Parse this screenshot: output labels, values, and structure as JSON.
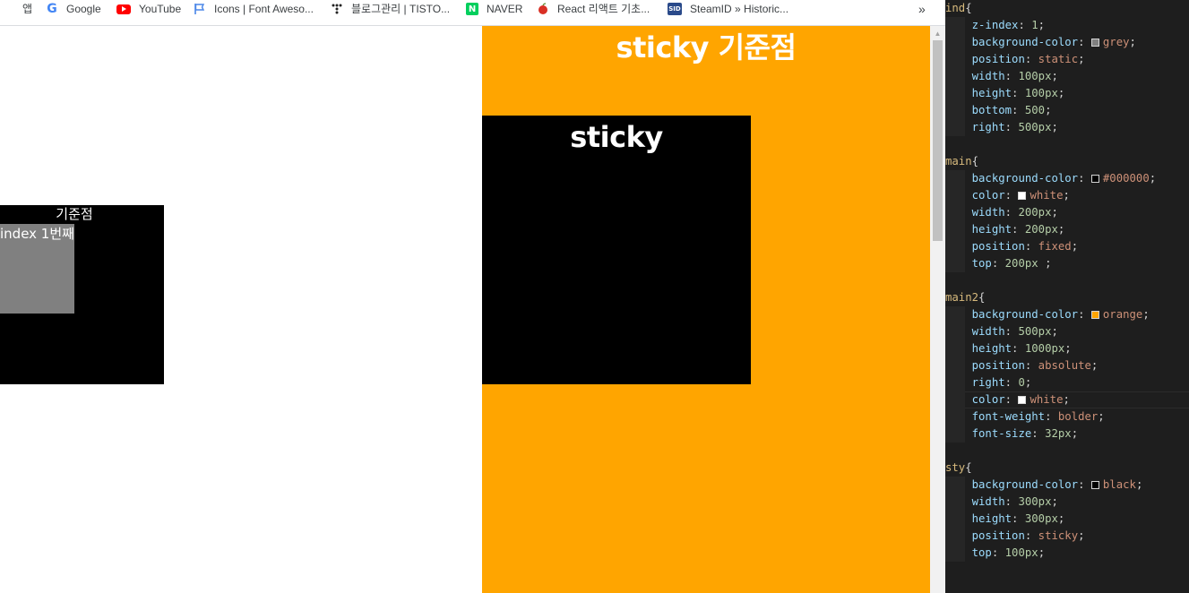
{
  "bookmarks": [
    {
      "label": "앱",
      "icon": "apps-grid-icon"
    },
    {
      "label": "Google",
      "icon": "google-icon"
    },
    {
      "label": "YouTube",
      "icon": "youtube-icon"
    },
    {
      "label": "Icons | Font Aweso...",
      "icon": "flag-icon"
    },
    {
      "label": "블로그관리 | TISTO...",
      "icon": "tistory-icon"
    },
    {
      "label": "NAVER",
      "icon": "naver-icon"
    },
    {
      "label": "React 리액트 기초...",
      "icon": "apple-icon"
    },
    {
      "label": "SteamID » Historic...",
      "icon": "steamid-icon"
    }
  ],
  "bookmarks_more": "»",
  "page": {
    "main2_title": "sticky 기준점",
    "sticky_label": "sticky",
    "main_label": "기준점",
    "ind_label": "index 1번째"
  },
  "colors": {
    "main2_bg": "#ffa500",
    "sty_bg": "#000000",
    "main_bg": "#000000",
    "ind_bg": "#808080",
    "editor_bg": "#1e1e1e"
  },
  "editor": {
    "lines": [
      [
        {
          "t": "ind",
          "c": "sel"
        },
        {
          "t": "{",
          "c": "brace"
        }
      ],
      [
        {
          "t": "    "
        },
        {
          "t": "z-index",
          "c": "prop"
        },
        {
          "t": ": "
        },
        {
          "t": "1",
          "c": "num"
        },
        {
          "t": ";"
        }
      ],
      [
        {
          "t": "    "
        },
        {
          "t": "background-color",
          "c": "prop"
        },
        {
          "t": ": "
        },
        {
          "sw": "#808080"
        },
        {
          "t": "grey",
          "c": "str"
        },
        {
          "t": ";"
        }
      ],
      [
        {
          "t": "    "
        },
        {
          "t": "position",
          "c": "prop"
        },
        {
          "t": ": "
        },
        {
          "t": "static",
          "c": "str"
        },
        {
          "t": ";"
        }
      ],
      [
        {
          "t": "    "
        },
        {
          "t": "width",
          "c": "prop"
        },
        {
          "t": ": "
        },
        {
          "t": "100px",
          "c": "num"
        },
        {
          "t": ";"
        }
      ],
      [
        {
          "t": "    "
        },
        {
          "t": "height",
          "c": "prop"
        },
        {
          "t": ": "
        },
        {
          "t": "100px",
          "c": "num"
        },
        {
          "t": ";"
        }
      ],
      [
        {
          "t": "    "
        },
        {
          "t": "bottom",
          "c": "prop"
        },
        {
          "t": ": "
        },
        {
          "t": "500",
          "c": "num"
        },
        {
          "t": ";"
        }
      ],
      [
        {
          "t": "    "
        },
        {
          "t": "right",
          "c": "prop"
        },
        {
          "t": ": "
        },
        {
          "t": "500px",
          "c": "num"
        },
        {
          "t": ";"
        }
      ],
      [],
      [
        {
          "t": "main",
          "c": "sel"
        },
        {
          "t": "{",
          "c": "brace"
        }
      ],
      [
        {
          "t": "    "
        },
        {
          "t": "background-color",
          "c": "prop"
        },
        {
          "t": ": "
        },
        {
          "sw": "#000000"
        },
        {
          "t": "#000000",
          "c": "str"
        },
        {
          "t": ";"
        }
      ],
      [
        {
          "t": "    "
        },
        {
          "t": "color",
          "c": "prop"
        },
        {
          "t": ": "
        },
        {
          "sw": "#ffffff"
        },
        {
          "t": "white",
          "c": "str"
        },
        {
          "t": ";"
        }
      ],
      [
        {
          "t": "    "
        },
        {
          "t": "width",
          "c": "prop"
        },
        {
          "t": ": "
        },
        {
          "t": "200px",
          "c": "num"
        },
        {
          "t": ";"
        }
      ],
      [
        {
          "t": "    "
        },
        {
          "t": "height",
          "c": "prop"
        },
        {
          "t": ": "
        },
        {
          "t": "200px",
          "c": "num"
        },
        {
          "t": ";"
        }
      ],
      [
        {
          "t": "    "
        },
        {
          "t": "position",
          "c": "prop"
        },
        {
          "t": ": "
        },
        {
          "t": "fixed",
          "c": "str"
        },
        {
          "t": ";"
        }
      ],
      [
        {
          "t": "    "
        },
        {
          "t": "top",
          "c": "prop"
        },
        {
          "t": ": "
        },
        {
          "t": "200px",
          "c": "num"
        },
        {
          "t": " ;"
        }
      ],
      [],
      [
        {
          "t": "main2",
          "c": "sel"
        },
        {
          "t": "{",
          "c": "brace"
        }
      ],
      [
        {
          "t": "    "
        },
        {
          "t": "background-color",
          "c": "prop"
        },
        {
          "t": ": "
        },
        {
          "sw": "#ffa500"
        },
        {
          "t": "orange",
          "c": "str"
        },
        {
          "t": ";"
        }
      ],
      [
        {
          "t": "    "
        },
        {
          "t": "width",
          "c": "prop"
        },
        {
          "t": ": "
        },
        {
          "t": "500px",
          "c": "num"
        },
        {
          "t": ";"
        }
      ],
      [
        {
          "t": "    "
        },
        {
          "t": "height",
          "c": "prop"
        },
        {
          "t": ": "
        },
        {
          "t": "1000px",
          "c": "num"
        },
        {
          "t": ";"
        }
      ],
      [
        {
          "t": "    "
        },
        {
          "t": "position",
          "c": "prop"
        },
        {
          "t": ": "
        },
        {
          "t": "absolute",
          "c": "str"
        },
        {
          "t": ";"
        }
      ],
      [
        {
          "t": "    "
        },
        {
          "t": "right",
          "c": "prop"
        },
        {
          "t": ": "
        },
        {
          "t": "0",
          "c": "num"
        },
        {
          "t": ";"
        }
      ],
      [
        {
          "t": "    "
        },
        {
          "t": "color",
          "c": "prop"
        },
        {
          "t": ": "
        },
        {
          "sw": "#ffffff"
        },
        {
          "t": "white",
          "c": "str"
        },
        {
          "t": ";"
        }
      ],
      [
        {
          "t": "    "
        },
        {
          "t": "font-weight",
          "c": "prop"
        },
        {
          "t": ": "
        },
        {
          "t": "bolder",
          "c": "str"
        },
        {
          "t": ";"
        }
      ],
      [
        {
          "t": "    "
        },
        {
          "t": "font-size",
          "c": "prop"
        },
        {
          "t": ": "
        },
        {
          "t": "32px",
          "c": "num"
        },
        {
          "t": ";"
        }
      ],
      [],
      [
        {
          "t": "sty",
          "c": "sel"
        },
        {
          "t": "{",
          "c": "brace"
        }
      ],
      [
        {
          "t": "    "
        },
        {
          "t": "background-color",
          "c": "prop"
        },
        {
          "t": ": "
        },
        {
          "sw": "#000000"
        },
        {
          "t": "black",
          "c": "str"
        },
        {
          "t": ";"
        }
      ],
      [
        {
          "t": "    "
        },
        {
          "t": "width",
          "c": "prop"
        },
        {
          "t": ": "
        },
        {
          "t": "300px",
          "c": "num"
        },
        {
          "t": ";"
        }
      ],
      [
        {
          "t": "    "
        },
        {
          "t": "height",
          "c": "prop"
        },
        {
          "t": ": "
        },
        {
          "t": "300px",
          "c": "num"
        },
        {
          "t": ";"
        }
      ],
      [
        {
          "t": "    "
        },
        {
          "t": "position",
          "c": "prop"
        },
        {
          "t": ": "
        },
        {
          "t": "sticky",
          "c": "str"
        },
        {
          "t": ";"
        }
      ],
      [
        {
          "t": "    "
        },
        {
          "t": "top",
          "c": "prop"
        },
        {
          "t": ": "
        },
        {
          "t": "100px",
          "c": "num"
        },
        {
          "t": ";"
        }
      ]
    ]
  }
}
